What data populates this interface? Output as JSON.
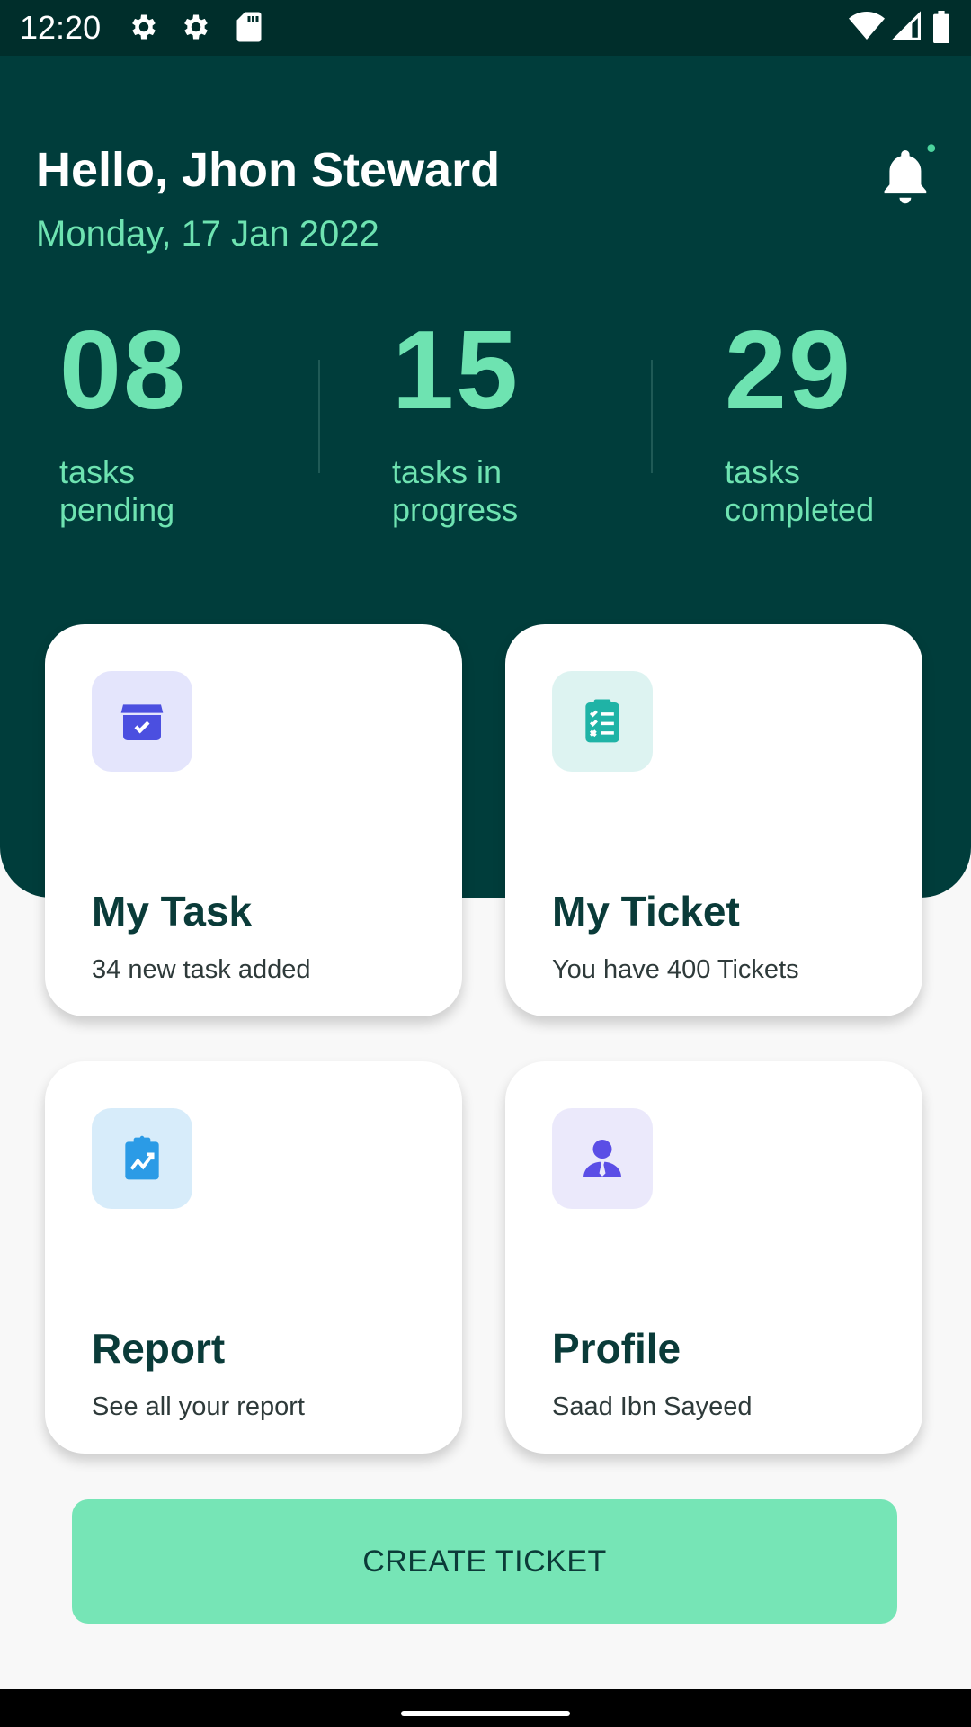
{
  "status_bar": {
    "time": "12:20"
  },
  "header": {
    "greeting": "Hello, Jhon Steward",
    "date": "Monday, 17 Jan 2022"
  },
  "stats": [
    {
      "value": "08",
      "label": "tasks pending"
    },
    {
      "value": "15",
      "label": "tasks in progress"
    },
    {
      "value": "29",
      "label": "tasks completed"
    }
  ],
  "cards": [
    {
      "title": "My Task",
      "subtitle": "34 new task added",
      "icon": "task-box-icon"
    },
    {
      "title": "My Ticket",
      "subtitle": "You have 400 Tickets",
      "icon": "checklist-icon"
    },
    {
      "title": "Report",
      "subtitle": "See all your report",
      "icon": "report-clipboard-icon"
    },
    {
      "title": "Profile",
      "subtitle": "Saad Ibn Sayeed",
      "icon": "profile-person-icon"
    }
  ],
  "create_button_label": "CREATE TICKET",
  "colors": {
    "header_bg": "#003d3b",
    "accent": "#6ee3b1",
    "button_bg": "#76e5b6"
  }
}
